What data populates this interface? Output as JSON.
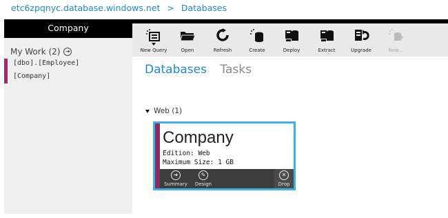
{
  "breadcrumb": {
    "server": "etc6zpqnyc.database.windows.net",
    "separator": ">",
    "current": "Databases"
  },
  "sidebar": {
    "header": "Company",
    "my_work": "My Work (2)",
    "selected_lines": [
      "[dbo].[Employee]",
      "[Company]"
    ]
  },
  "toolbar": {
    "buttons": [
      {
        "label": "New Query",
        "icon": "new-query-icon"
      },
      {
        "label": "Open",
        "icon": "folder-open-icon"
      },
      {
        "label": "Refresh",
        "icon": "refresh-icon"
      },
      {
        "label": "Create",
        "icon": "create-database-icon"
      },
      {
        "label": "Deploy",
        "icon": "deploy-icon"
      },
      {
        "label": "Extract",
        "icon": "extract-icon"
      },
      {
        "label": "Upgrade",
        "icon": "upgrade-icon"
      },
      {
        "label": "New...",
        "icon": "new-disabled-icon"
      }
    ]
  },
  "tabs": {
    "databases": "Databases",
    "tasks": "Tasks"
  },
  "group": {
    "label": "Web (1)"
  },
  "tile": {
    "title": "Company",
    "edition": "Edition: Web",
    "max_size": "Maximum Size: 1 GB",
    "actions": {
      "summary": "Summary",
      "design": "Design",
      "drop": "Drop"
    }
  },
  "colors": {
    "accent": "#1e8bd0",
    "tile_border": "#3fb0e6",
    "tile_bar": "#8b2b5c",
    "selection_bar": "#a12b69"
  }
}
